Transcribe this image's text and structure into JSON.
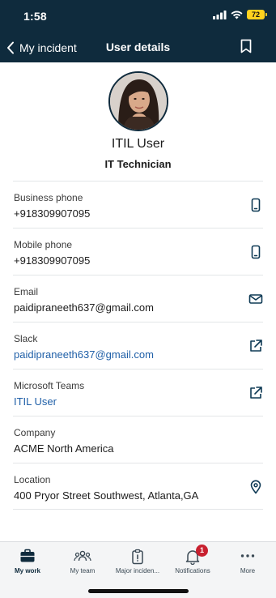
{
  "status_bar": {
    "time": "1:58",
    "battery": "72"
  },
  "nav": {
    "back_label": "My incident",
    "title": "User details"
  },
  "profile": {
    "name": "ITIL User",
    "role": "IT Technician"
  },
  "details": [
    {
      "label": "Business phone",
      "value": "+918309907095",
      "action_icon": "phone-icon"
    },
    {
      "label": "Mobile phone",
      "value": "+918309907095",
      "action_icon": "phone-icon"
    },
    {
      "label": "Email",
      "value": "paidipraneeth637@gmail.com",
      "action_icon": "mail-icon"
    },
    {
      "label": "Slack",
      "value": "paidipraneeth637@gmail.com",
      "action_icon": "external-link-icon"
    },
    {
      "label": "Microsoft Teams",
      "value": "ITIL User",
      "action_icon": "external-link-icon"
    },
    {
      "label": "Company",
      "value": "ACME North America"
    },
    {
      "label": "Location",
      "value": "400 Pryor Street Southwest, Atlanta,GA",
      "action_icon": "location-pin-icon"
    }
  ],
  "tabs": [
    {
      "label": "My work",
      "icon": "briefcase-icon",
      "active": true
    },
    {
      "label": "My team",
      "icon": "team-icon"
    },
    {
      "label": "Major inciden...",
      "icon": "clipboard-alert-icon"
    },
    {
      "label": "Notifications",
      "icon": "bell-icon",
      "badge": "1"
    },
    {
      "label": "More",
      "icon": "more-dots-icon"
    }
  ],
  "colors": {
    "header_bg": "#0f2b3d",
    "link": "#2060a8",
    "badge": "#c8202f",
    "icon": "#0f3a55"
  }
}
